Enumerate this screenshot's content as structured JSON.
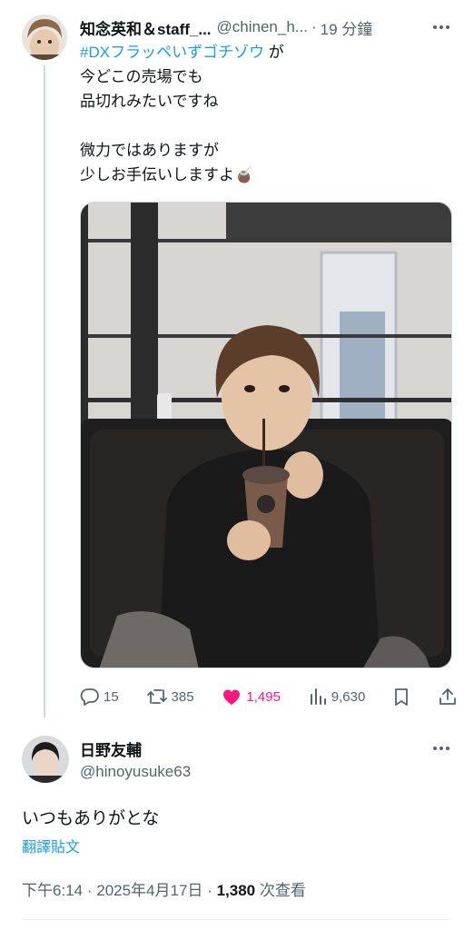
{
  "tweet": {
    "author_name": "知念英和＆staff_...",
    "handle": "@chinen_h...",
    "separator": "·",
    "time": "19 分鐘",
    "hashtag": "#DXフラッペいずゴチゾウ",
    "line1_suffix": " が",
    "line2": "今どこの売場でも",
    "line3": "品切れみたいですね",
    "line4": "微力ではありますが",
    "line5": "少しお手伝いしますよ",
    "emoji": "🧉",
    "stats": {
      "replies": "15",
      "retweets": "385",
      "likes": "1,495",
      "views": "9,630"
    },
    "like_color": "#f91880",
    "link_color": "#1d9bf0"
  },
  "reply": {
    "author_name": "日野友輔",
    "handle": "@hinoyusuke63",
    "text": "いつもありがとな",
    "translate": "翻譯貼文",
    "time": "下午6:14",
    "dot1": "·",
    "date": "2025年4月17日",
    "dot2": "·",
    "views": "1,380",
    "views_label": "次查看"
  },
  "icons": [
    "more-icon",
    "reply-icon",
    "retweet-icon",
    "heart-icon",
    "views-icon",
    "bookmark-icon",
    "share-icon"
  ]
}
